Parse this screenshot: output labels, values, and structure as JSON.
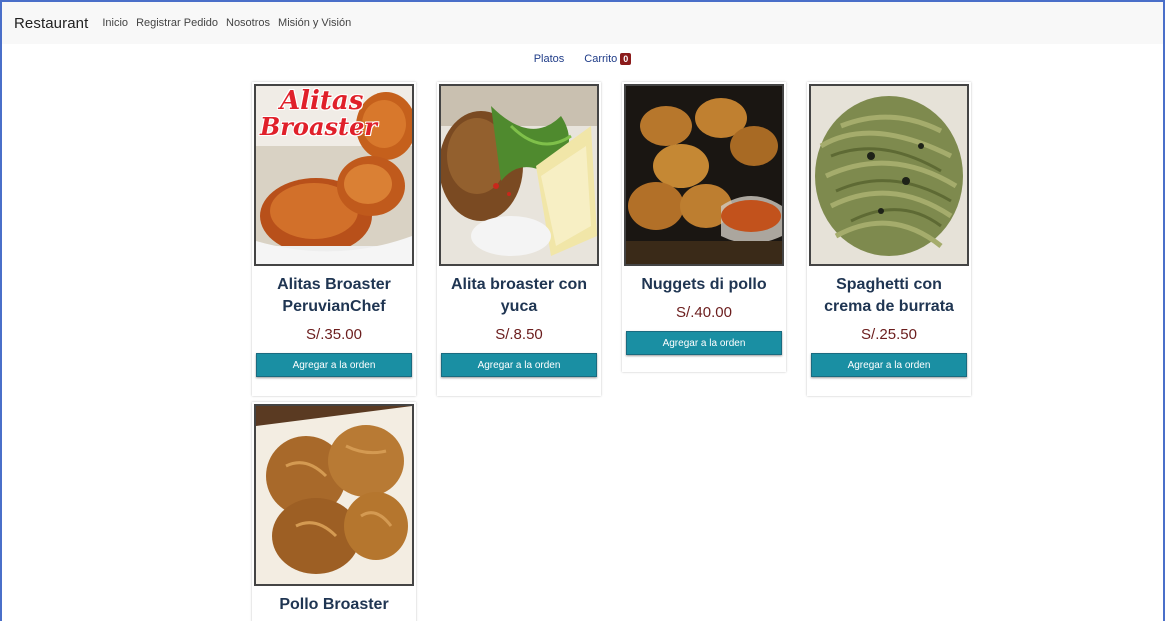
{
  "navbar": {
    "brand": "Restaurant",
    "links": [
      "Inicio",
      "Registrar Pedido",
      "Nosotros",
      "Misión y Visión"
    ]
  },
  "subnav": {
    "platos": "Platos",
    "carrito": "Carrito",
    "cart_count": "0"
  },
  "products": [
    {
      "title_line1": "Alitas Broaster",
      "title_line2": "PeruvianChef",
      "price": "S/.35.00",
      "button": "Agregar a la orden",
      "logo_line1": "Alitas",
      "logo_line2": "Broaster"
    },
    {
      "title_line1": "Alita broaster con",
      "title_line2": "yuca",
      "price": "S/.8.50",
      "button": "Agregar a la orden"
    },
    {
      "title_line1": "Nuggets di pollo",
      "title_line2": "",
      "price": "S/.40.00",
      "button": "Agregar a la orden"
    },
    {
      "title_line1": "Spaghetti con",
      "title_line2": "crema de burrata",
      "price": "S/.25.50",
      "button": "Agregar a la orden"
    },
    {
      "title_line1": "Pollo Broaster",
      "title_line2": "",
      "price": "",
      "button": ""
    }
  ],
  "colors": {
    "accent": "#1a8fa3",
    "price": "#6b1d1d",
    "title": "#1f3552",
    "badge": "#8b1b1b",
    "frame": "#4a6fc9"
  }
}
